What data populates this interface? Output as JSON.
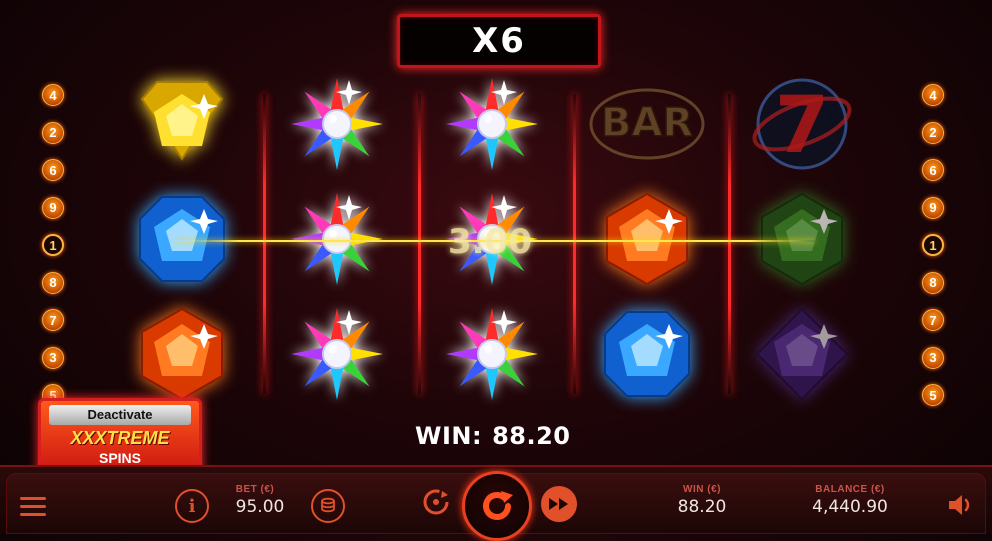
{
  "game": {
    "multiplier": "X6",
    "line_win": "3.00",
    "win_label": "WIN:",
    "win_amount": "88.20"
  },
  "paylines_left": [
    "4",
    "2",
    "6",
    "9",
    "1",
    "8",
    "7",
    "3",
    "5"
  ],
  "paylines_right": [
    "4",
    "2",
    "6",
    "9",
    "1",
    "8",
    "7",
    "3",
    "5"
  ],
  "reels": [
    [
      "yellow-gem",
      "blue-gem",
      "orange-gem"
    ],
    [
      "star-wild",
      "star-wild",
      "star-wild"
    ],
    [
      "star-wild",
      "star-wild",
      "star-wild"
    ],
    [
      "bar",
      "orange-gem",
      "blue-gem"
    ],
    [
      "seven",
      "green-gem",
      "purple-gem"
    ]
  ],
  "feature_button": {
    "top": "Deactivate",
    "middle": "XXXTREME",
    "bottom": "SPINS"
  },
  "controls": {
    "bet_label": "BET (€)",
    "bet_value": "95.00",
    "win_label": "WIN (€)",
    "win_value": "88.20",
    "balance_label": "BALANCE (€)",
    "balance_value": "4,440.90",
    "info_glyph": "i"
  },
  "colors": {
    "accent": "#e0502a",
    "frame_red": "#c3141c",
    "background": "#1e0508"
  }
}
